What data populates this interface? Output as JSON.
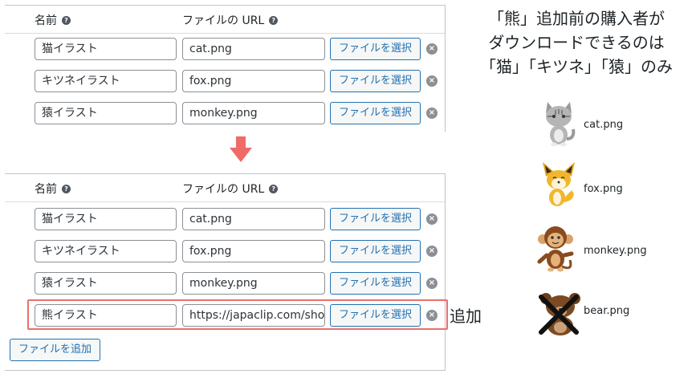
{
  "before": {
    "headers": {
      "name": "名前",
      "url": "ファイルの URL"
    },
    "rows": [
      {
        "name": "猫イラスト",
        "url": "cat.png",
        "button": "ファイルを選択"
      },
      {
        "name": "キツネイラスト",
        "url": "fox.png",
        "button": "ファイルを選択"
      },
      {
        "name": "猿イラスト",
        "url": "monkey.png",
        "button": "ファイルを選択"
      }
    ]
  },
  "after": {
    "headers": {
      "name": "名前",
      "url": "ファイルの URL"
    },
    "rows": [
      {
        "name": "猫イラスト",
        "url": "cat.png",
        "button": "ファイルを選択"
      },
      {
        "name": "キツネイラスト",
        "url": "fox.png",
        "button": "ファイルを選択"
      },
      {
        "name": "猿イラスト",
        "url": "monkey.png",
        "button": "ファイルを選択"
      },
      {
        "name": "熊イラスト",
        "url": "https://japaclip.com/shop/",
        "button": "ファイルを選択"
      }
    ],
    "add_button": "ファイルを追加",
    "added_label": "追加"
  },
  "caption": {
    "line1": "「熊」追加前の購入者が",
    "line2": "ダウンロードできるのは",
    "line3": "「猫」「キツネ」「猿」のみ"
  },
  "files": [
    {
      "label": "cat.png",
      "icon": "cat-icon"
    },
    {
      "label": "fox.png",
      "icon": "fox-icon"
    },
    {
      "label": "monkey.png",
      "icon": "monkey-icon"
    },
    {
      "label": "bear.png",
      "icon": "bear-icon",
      "crossed_out": true
    }
  ],
  "colors": {
    "accent": "#2271b1",
    "highlight": "#e8706d",
    "arrow": "#f06a67"
  }
}
